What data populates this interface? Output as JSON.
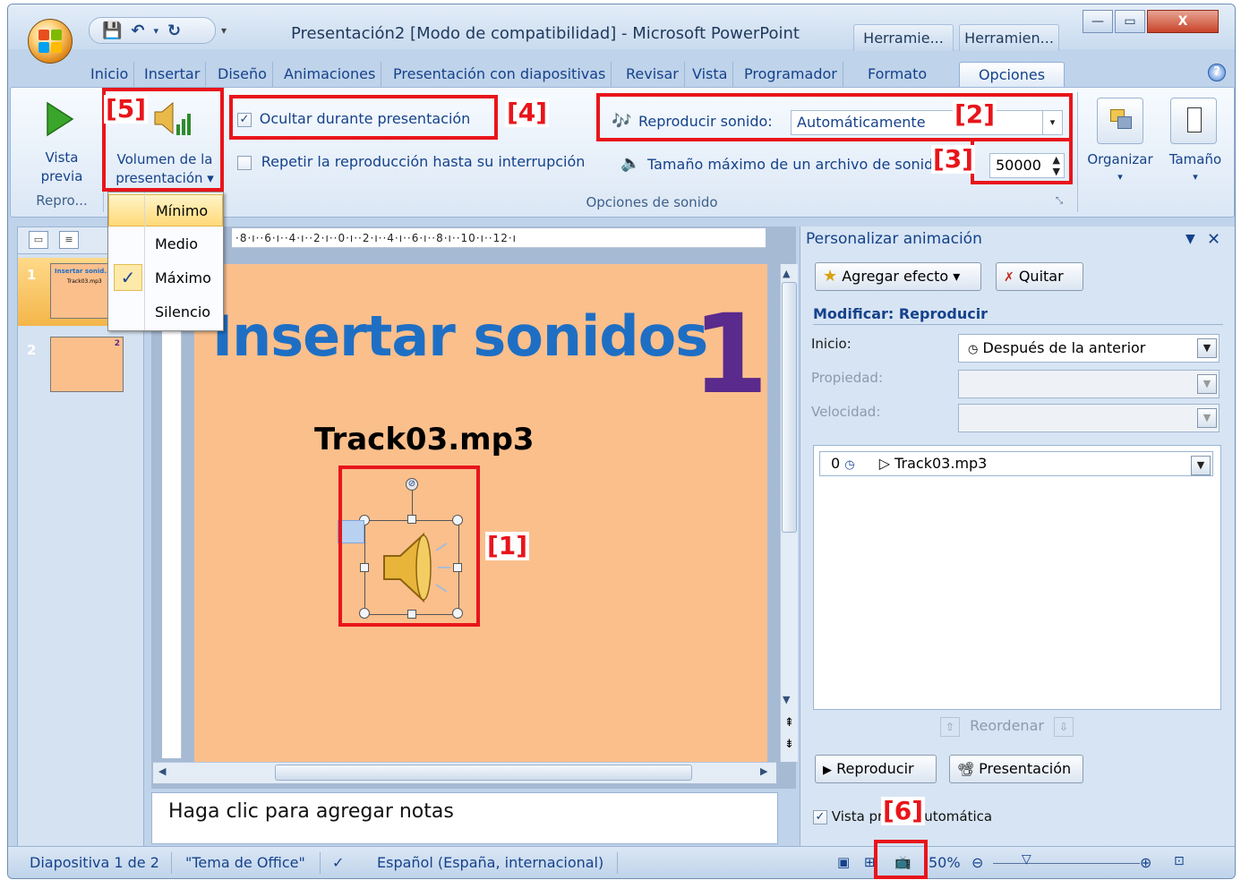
{
  "window": {
    "title": "Presentación2 [Modo de compatibilidad] - Microsoft PowerPoint",
    "contextual_tabs": [
      "Herramie...",
      "Herramien..."
    ],
    "controls": {
      "minimize": "—",
      "maximize": "▭",
      "close": "X"
    }
  },
  "qat": {
    "save_icon": "save-icon",
    "undo_icon": "undo-icon",
    "redo_icon": "redo-icon"
  },
  "tabs": [
    "Inicio",
    "Insertar",
    "Diseño",
    "Animaciones",
    "Presentación con diapositivas",
    "Revisar",
    "Vista",
    "Programador",
    "Formato",
    "Opciones"
  ],
  "active_tab": "Opciones",
  "ribbon": {
    "preview": {
      "label_line1": "Vista",
      "label_line2": "previa",
      "group": "Repro..."
    },
    "volume": {
      "label_line1": "Volumen de la",
      "label_line2": "presentación ▾"
    },
    "hide_during_show": {
      "label": "Ocultar durante presentación",
      "checked": true
    },
    "loop": {
      "label": "Repetir la reproducción hasta su interrupción",
      "checked": false
    },
    "play_sound": {
      "label": "Reproducir sonido:",
      "value": "Automáticamente"
    },
    "max_size": {
      "label": "Tamaño máximo de un archivo de sonid",
      "value": "50000"
    },
    "sound_group_label": "Opciones de sonido",
    "arrange": {
      "label": "Organizar"
    },
    "size": {
      "label": "Tamaño"
    }
  },
  "volume_menu": {
    "items": [
      "Mínimo",
      "Medio",
      "Máximo",
      "Silencio"
    ],
    "hovered": "Mínimo",
    "checked": "Máximo"
  },
  "annotations": [
    "[1]",
    "[2]",
    "[3]",
    "[4]",
    "[5]",
    "[6]"
  ],
  "slides": [
    {
      "number": "1",
      "mini_title": "Insertar sonid...",
      "mini_sub": "Track03.mp3"
    },
    {
      "number": "2",
      "mini_badge": "2"
    }
  ],
  "ruler": {
    "h_text": "·8·ı··6·ı··4·ı··2·ı··0·ı··2·ı··4·ı··6·ı··8·ı··10·ı··12·ı"
  },
  "slide": {
    "title": "Insertar sonidos",
    "number": "1",
    "track_label": "Track03.mp3"
  },
  "notes": {
    "placeholder": "Haga clic para agregar notas"
  },
  "taskpane": {
    "title": "Personalizar animación",
    "add_effect": "Agregar efecto ▾",
    "remove": "Quitar",
    "section": "Modificar: Reproducir",
    "start_label": "Inicio:",
    "start_value": "Después de la anterior",
    "property_label": "Propiedad:",
    "speed_label": "Velocidad:",
    "list_item": {
      "order": "0",
      "name": "Track03.mp3"
    },
    "reorder": "Reordenar",
    "play": "Reproducir",
    "slideshow": "Presentación",
    "autopreview": {
      "label_start": "Vista pr",
      "label_end": "utomática",
      "checked": true
    }
  },
  "statusbar": {
    "slide_info": "Diapositiva 1 de 2",
    "theme": "\"Tema de Office\"",
    "language": "Español (España, internacional)",
    "zoom": "50%"
  },
  "colors": {
    "accent_red": "#e8151b",
    "slide_bg": "#fbbf8c",
    "title_blue": "#1e6fc4",
    "number_purple": "#5a2a8c"
  }
}
